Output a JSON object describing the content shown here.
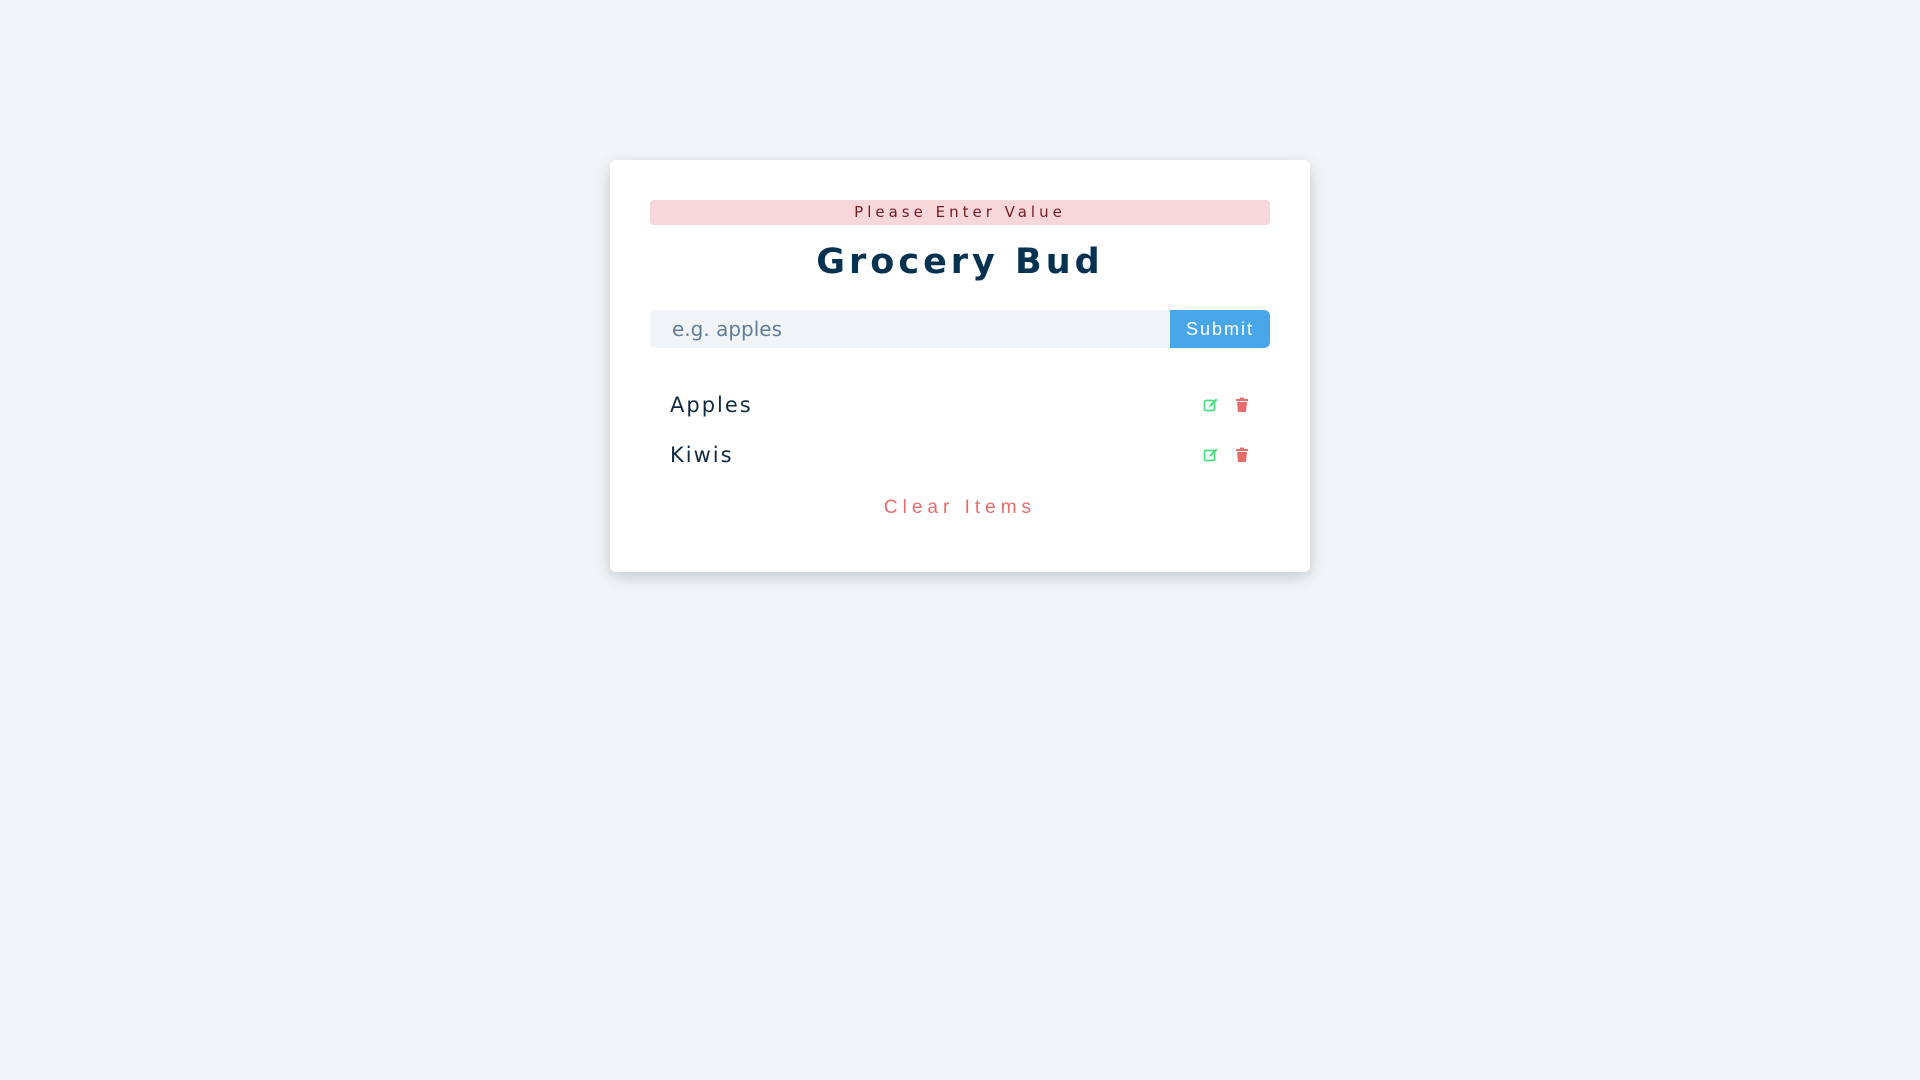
{
  "alert": {
    "text": "Please Enter Value"
  },
  "app": {
    "title": "Grocery Bud"
  },
  "form": {
    "placeholder": "e.g. apples",
    "submit_label": "Submit"
  },
  "items": [
    {
      "name": "Apples",
      "edit_icon": "edit-icon",
      "delete_icon": "trash-icon"
    },
    {
      "name": "Kiwis",
      "edit_icon": "edit-icon",
      "delete_icon": "trash-icon"
    }
  ],
  "clear_label": "Clear Items",
  "colors": {
    "background": "#f1f5f8",
    "alert_bg": "#f8d7da",
    "title": "#063251",
    "submit": "#49a6e9",
    "edit": "#4ade80",
    "delete": "#e66b6b",
    "clear": "#e66b6b"
  }
}
